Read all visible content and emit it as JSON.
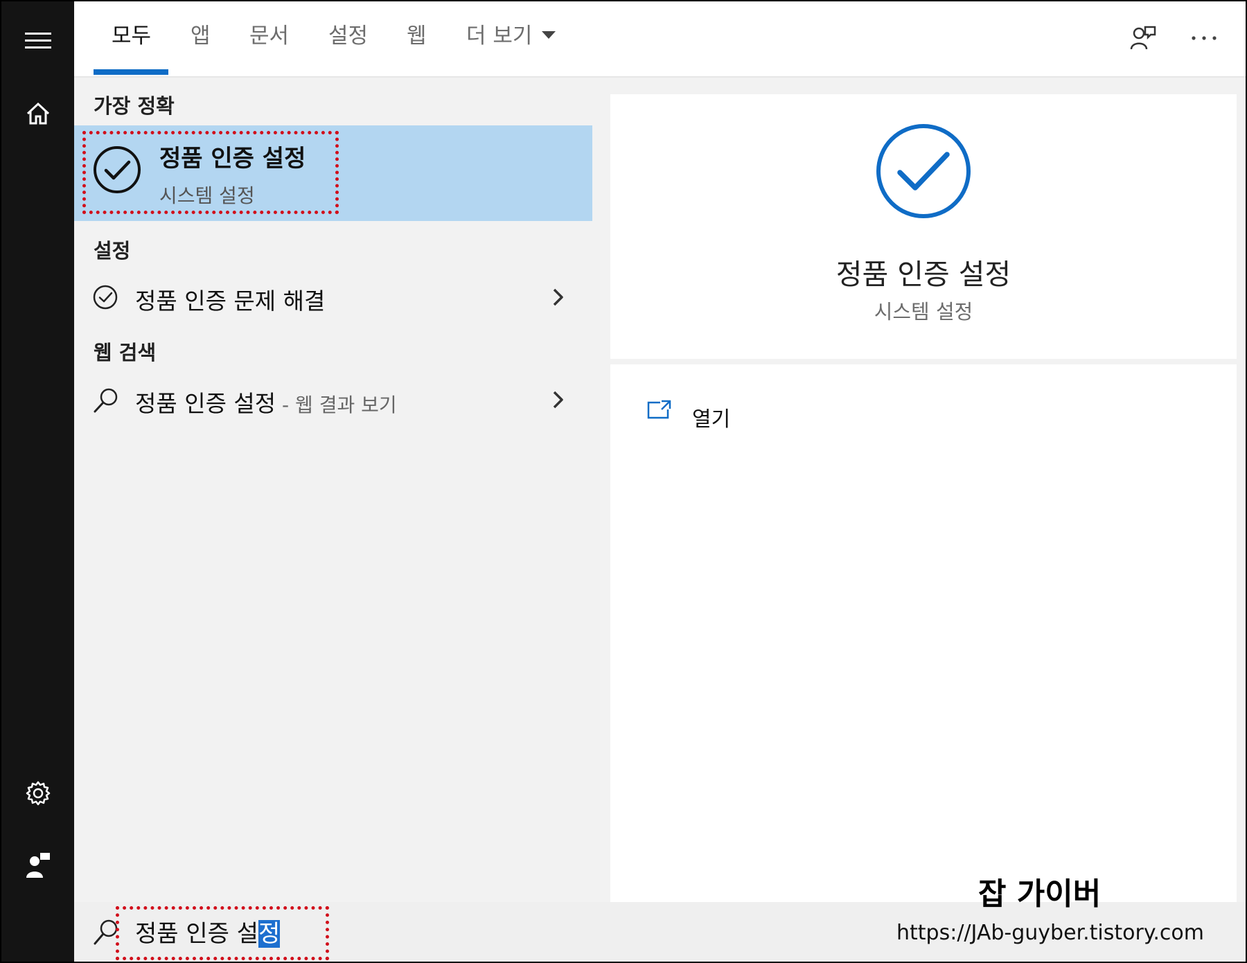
{
  "tabs": [
    {
      "label": "모두"
    },
    {
      "label": "앱"
    },
    {
      "label": "문서"
    },
    {
      "label": "설정"
    },
    {
      "label": "웹"
    },
    {
      "label": "더 보기"
    }
  ],
  "results": {
    "best_match_label": "가장 정확",
    "best_match": {
      "title": "정품 인증 설정",
      "subtitle": "시스템 설정"
    },
    "settings_label": "설정",
    "settings_item": {
      "title": "정품 인증 문제 해결"
    },
    "web_label": "웹 검색",
    "web_item": {
      "title": "정품 인증 설정",
      "suffix": " - 웹 결과 보기"
    }
  },
  "preview": {
    "title": "정품 인증 설정",
    "subtitle": "시스템 설정",
    "open_label": "열기"
  },
  "search": {
    "query_unselected": "정품 인증 설",
    "query_selected": "정"
  },
  "watermark": {
    "title": "잡 가이버",
    "url": "https://JAb-guyber.tistory.com"
  },
  "colors": {
    "accent": "#0f6cc6",
    "highlight": "#b3d6f1",
    "annotation": "#d10f1b",
    "rail": "#141414"
  }
}
